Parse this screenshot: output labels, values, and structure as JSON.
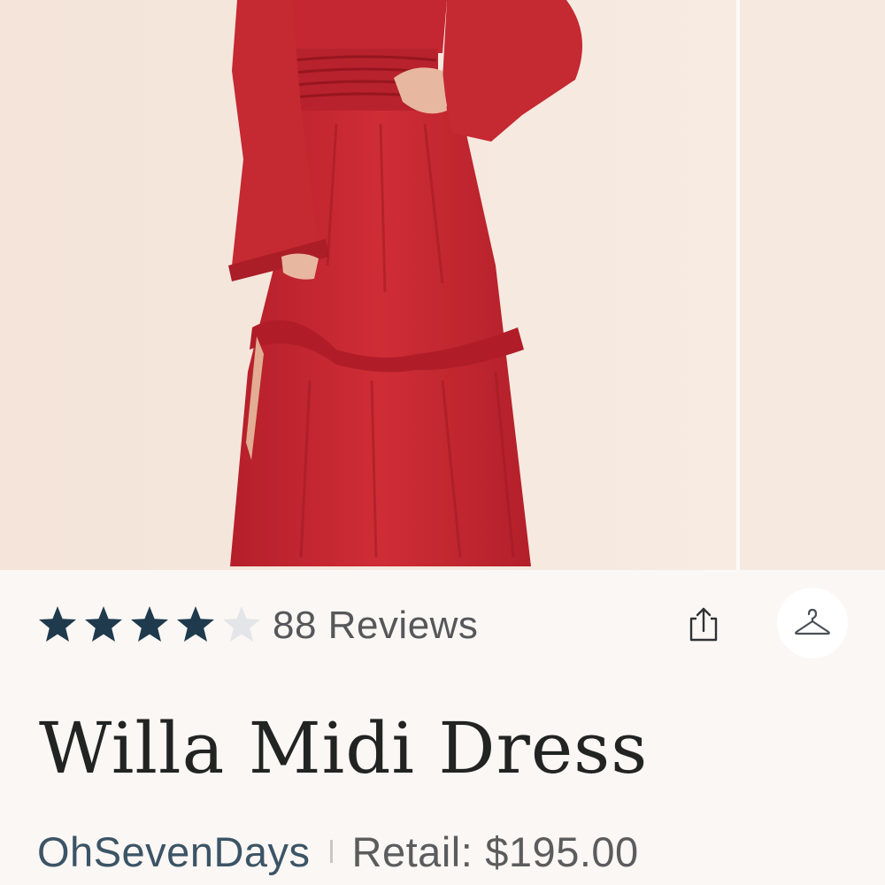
{
  "product": {
    "rating": 4,
    "rating_max": 5,
    "reviews_label": "88 Reviews",
    "title": "Willa Midi Dress",
    "brand": "OhSevenDays",
    "retail_label": "Retail:",
    "retail_price": "$195.00"
  },
  "icons": {
    "share": "share-icon",
    "closet": "hanger-icon",
    "star_filled": "star-filled-icon",
    "star_empty": "star-empty-icon"
  },
  "colors": {
    "star_filled": "#1f3a4d",
    "star_empty": "#e3e5e8",
    "brand": "#3b5466",
    "dress": "#c4262f",
    "background": "#faf7f4"
  }
}
